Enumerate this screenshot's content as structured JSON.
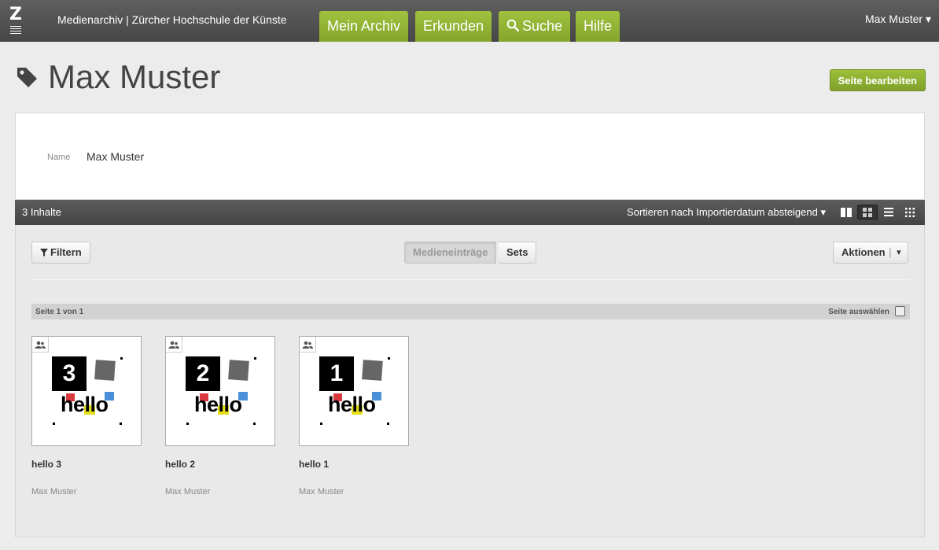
{
  "header": {
    "site_title": "Medienarchiv | Zürcher Hochschule der Künste",
    "logo_letter": "Z",
    "nav": [
      {
        "label": "Mein Archiv"
      },
      {
        "label": "Erkunden"
      },
      {
        "label": "Suche"
      },
      {
        "label": "Hilfe"
      }
    ],
    "user_menu": "Max Muster ▾"
  },
  "page": {
    "title": "Max Muster",
    "edit_button": "Seite bearbeiten"
  },
  "info": {
    "label": "Name",
    "value": "Max Muster"
  },
  "content_bar": {
    "count": "3 Inhalte",
    "sort": "Sortieren nach Importierdatum absteigend ▾",
    "active_view": "grid"
  },
  "toolbar": {
    "filter": "Filtern",
    "tab_media": "Medieneinträge",
    "tab_sets": "Sets",
    "actions": "Aktionen",
    "actions_caret": "▾"
  },
  "pagination": {
    "page_label": "Seite 1 von 1",
    "select_page": "Seite auswählen"
  },
  "media": [
    {
      "title": "hello 3",
      "owner": "Max Muster",
      "number": "3",
      "word": "hello"
    },
    {
      "title": "hello 2",
      "owner": "Max Muster",
      "number": "2",
      "word": "hello"
    },
    {
      "title": "hello 1",
      "owner": "Max Muster",
      "number": "1",
      "word": "hello"
    }
  ],
  "colors": {
    "accent_green": "#8fb132",
    "header_gray": "#4f4f4f",
    "art_gray": "#666666",
    "art_red": "#d9383f",
    "art_blue": "#4a90d9",
    "art_yellow": "#e6e01a"
  }
}
